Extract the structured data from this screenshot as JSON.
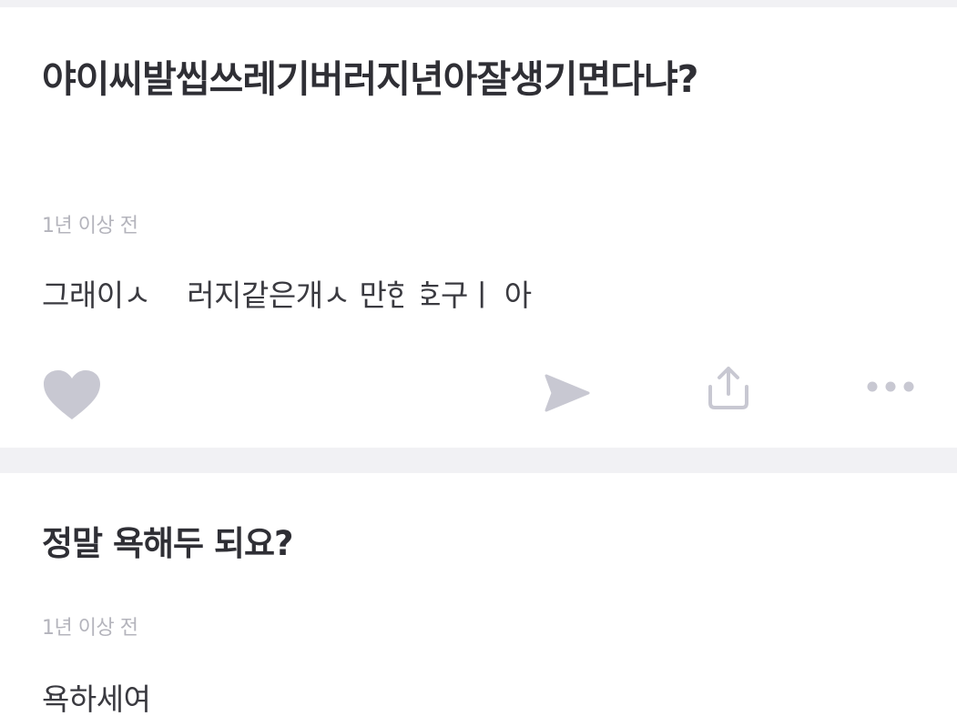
{
  "posts": [
    {
      "title": "야이씨발씹쓰레기버러지년아잘생기면다냐?",
      "time_ago": "1년 이상 전",
      "answer": "그래이ㅅ 버러지같은개ㅅ  만한호구ㅣ 아",
      "actions": {
        "like_icon": "heart-icon",
        "send_icon": "send-icon",
        "share_icon": "share-icon",
        "more_icon": "more-icon"
      }
    },
    {
      "title": "정말 욕해두 되요?",
      "time_ago": "1년 이상 전",
      "answer": "욕하세여"
    }
  ],
  "colors": {
    "icon": "#c8c8d2",
    "divider": "#f1f1f4",
    "meta_text": "#b4b4bc",
    "title_text": "#2f2f35"
  }
}
